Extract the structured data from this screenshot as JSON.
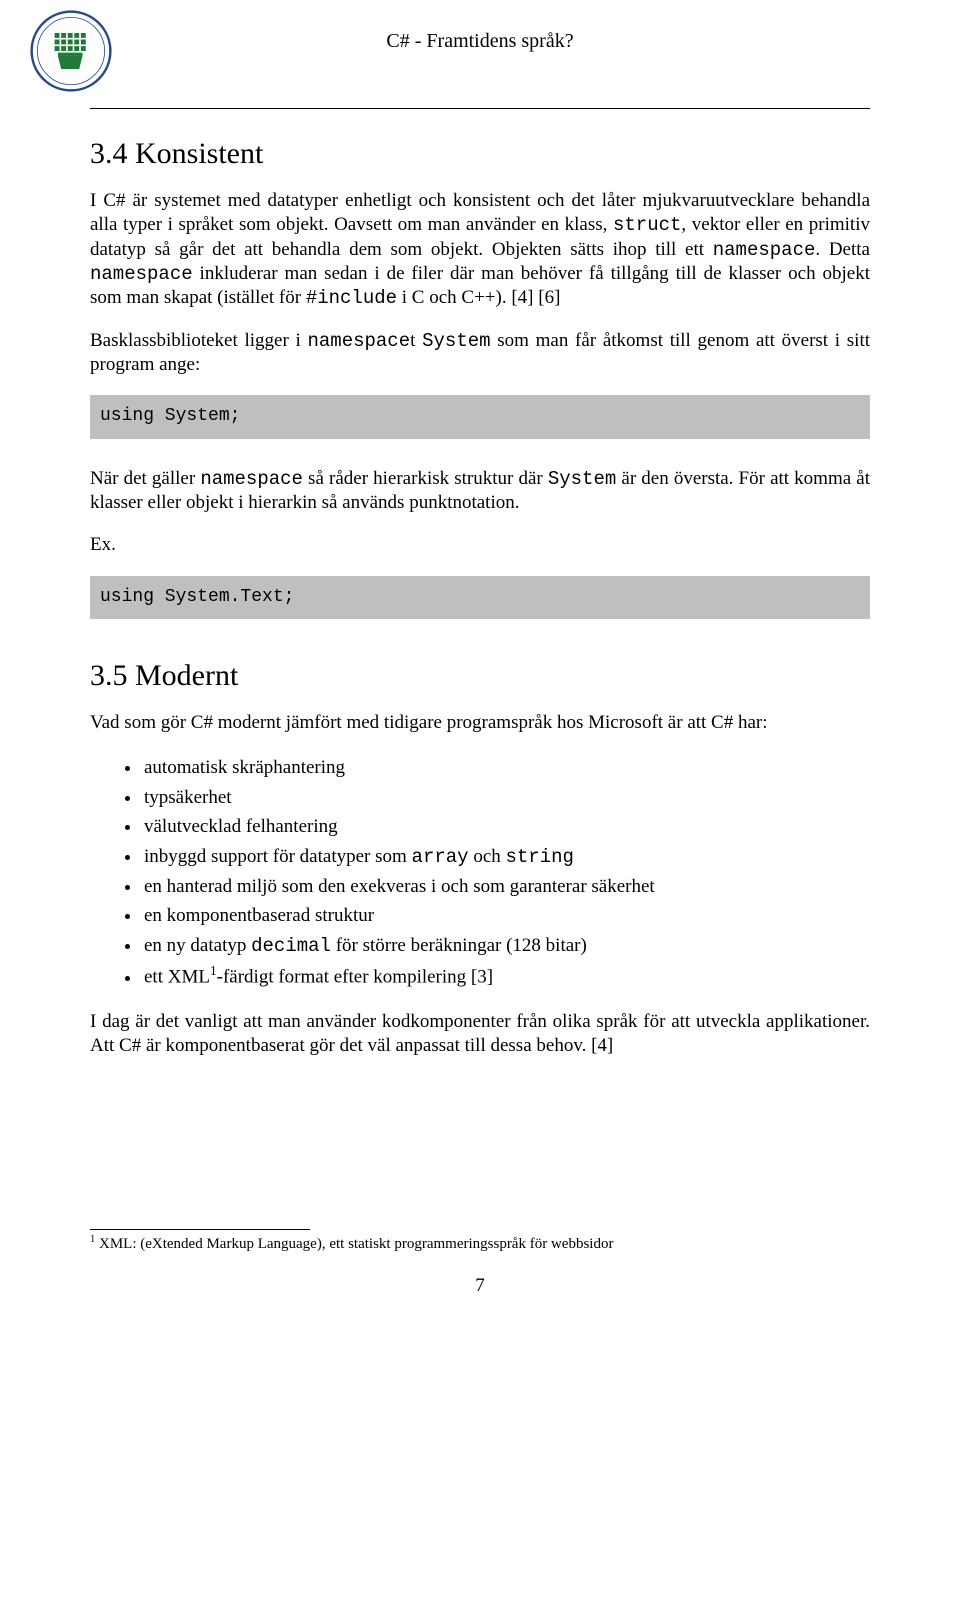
{
  "header": {
    "title": "C# - Framtidens språk?"
  },
  "sections": {
    "s34": {
      "heading": "3.4 Konsistent",
      "p1_a": "I C# är systemet med datatyper enhetligt och konsistent och det låter mjukvaruutvecklare behandla alla typer i språket som objekt. Oavsett om man använder en klass, ",
      "p1_struct": "struct",
      "p1_b": ", vektor eller en primitiv datatyp så går det att behandla dem som objekt. Objekten sätts ihop till ett ",
      "p1_ns1": "namespace",
      "p1_c": ". Detta ",
      "p1_ns2": "namespace",
      "p1_d": " inkluderar man sedan i de filer där man behöver få tillgång till de klasser och objekt som man skapat (istället för ",
      "p1_include": "#include",
      "p1_e": " i C och C++). [4] [6]",
      "p2_a": "Basklassbiblioteket ligger i ",
      "p2_ns": "namespace",
      "p2_b": "t ",
      "p2_sys": "System",
      "p2_c": " som man får åtkomst till genom att överst i sitt program ange:",
      "code1": "using System;",
      "p3_a": "När det gäller ",
      "p3_ns": "namespace",
      "p3_b": " så råder hierarkisk struktur där ",
      "p3_sys": "System",
      "p3_c": " är den översta. För att komma åt klasser eller objekt i hierarkin så används punktnotation.",
      "ex": "Ex.",
      "code2": "using System.Text;"
    },
    "s35": {
      "heading": "3.5 Modernt",
      "intro": "Vad som gör C# modernt jämfört med tidigare programspråk hos Microsoft är att C# har:",
      "items": {
        "i0": "automatisk skräphantering",
        "i1": "typsäkerhet",
        "i2": "välutvecklad felhantering",
        "i3_a": "inbyggd support för datatyper som ",
        "i3_arr": "array",
        "i3_b": " och ",
        "i3_str": "string",
        "i4": "en hanterad miljö som den exekveras i och som garanterar säkerhet",
        "i5": "en komponentbaserad struktur",
        "i6_a": "en ny datatyp ",
        "i6_dec": "decimal",
        "i6_b": " för större beräkningar (128 bitar)",
        "i7_a": "ett XML",
        "i7_sup": "1",
        "i7_b": "-färdigt format efter kompilering [3]"
      },
      "outro": "I dag är det vanligt att man använder kodkomponenter från olika språk för att utveckla applikationer. Att C# är komponentbaserat gör det väl anpassat till dessa behov. [4]"
    }
  },
  "footnote": {
    "marker": "1",
    "text": " XML: (eXtended Markup Language), ett statiskt programmeringsspråk för webbsidor"
  },
  "pagenum": "7"
}
